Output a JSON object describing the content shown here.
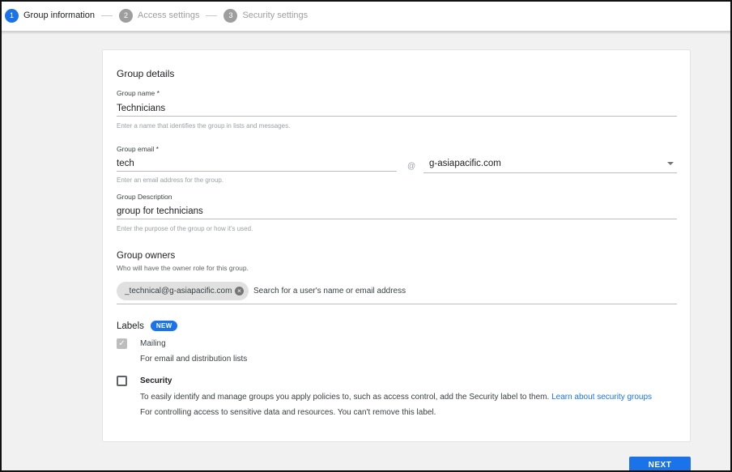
{
  "stepper": {
    "steps": [
      {
        "num": "1",
        "label": "Group information"
      },
      {
        "num": "2",
        "label": "Access settings"
      },
      {
        "num": "3",
        "label": "Security settings"
      }
    ]
  },
  "details": {
    "title": "Group details",
    "name_label": "Group name *",
    "name_value": "Technicians",
    "name_hint": "Enter a name that identifies the group in lists and messages.",
    "email_label": "Group email *",
    "email_value": "tech",
    "email_hint": "Enter an email address for the group.",
    "at_sign": "@",
    "domain_value": "g-asiapacific.com",
    "desc_label": "Group Description",
    "desc_value": "group for technicians",
    "desc_hint": "Enter the purpose of the group or how it's used."
  },
  "owners": {
    "title": "Group owners",
    "subtitle": "Who will have the owner role for this group.",
    "chip": "_technical@g-asiapacific.com",
    "search_placeholder": "Search for a user's name or email address"
  },
  "labels": {
    "title": "Labels",
    "badge": "NEW",
    "mailing_label": "Mailing",
    "mailing_desc": "For email and distribution lists",
    "security_label": "Security",
    "security_desc": "To easily identify and manage groups you apply policies to, such as access control, add the Security label to them.",
    "security_link": "Learn about security groups",
    "security_note": "For controlling access to sensitive data and resources. You can't remove this label."
  },
  "footer": {
    "next_label": "NEXT"
  }
}
